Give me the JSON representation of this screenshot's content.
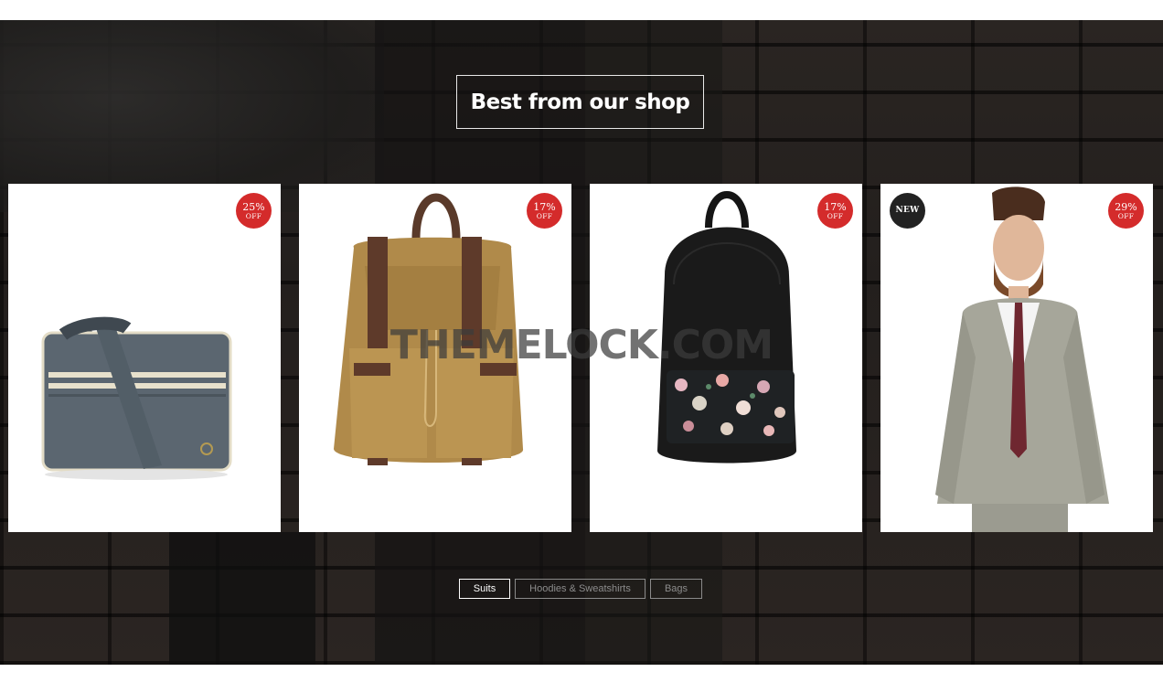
{
  "section": {
    "heading": "Best from our shop",
    "watermark": "THEMELOCK.COM"
  },
  "products": [
    {
      "name": "grey messenger bag",
      "badge": {
        "percent": "25%",
        "off": "OFF"
      }
    },
    {
      "name": "tan canvas rucksack",
      "badge": {
        "percent": "17%",
        "off": "OFF"
      }
    },
    {
      "name": "black floral backpack",
      "badge": {
        "percent": "17%",
        "off": "OFF"
      }
    },
    {
      "name": "grey suit model",
      "new_label": "NEW",
      "badge": {
        "percent": "29%",
        "off": "OFF"
      }
    }
  ],
  "filters": [
    {
      "label": "Suits",
      "active": true
    },
    {
      "label": "Hoodies & Sweatshirts",
      "active": false
    },
    {
      "label": "Bags",
      "active": false
    }
  ],
  "colors": {
    "badge_sale": "#d42b2b",
    "badge_new": "#222222",
    "background": "#1c1a19"
  }
}
